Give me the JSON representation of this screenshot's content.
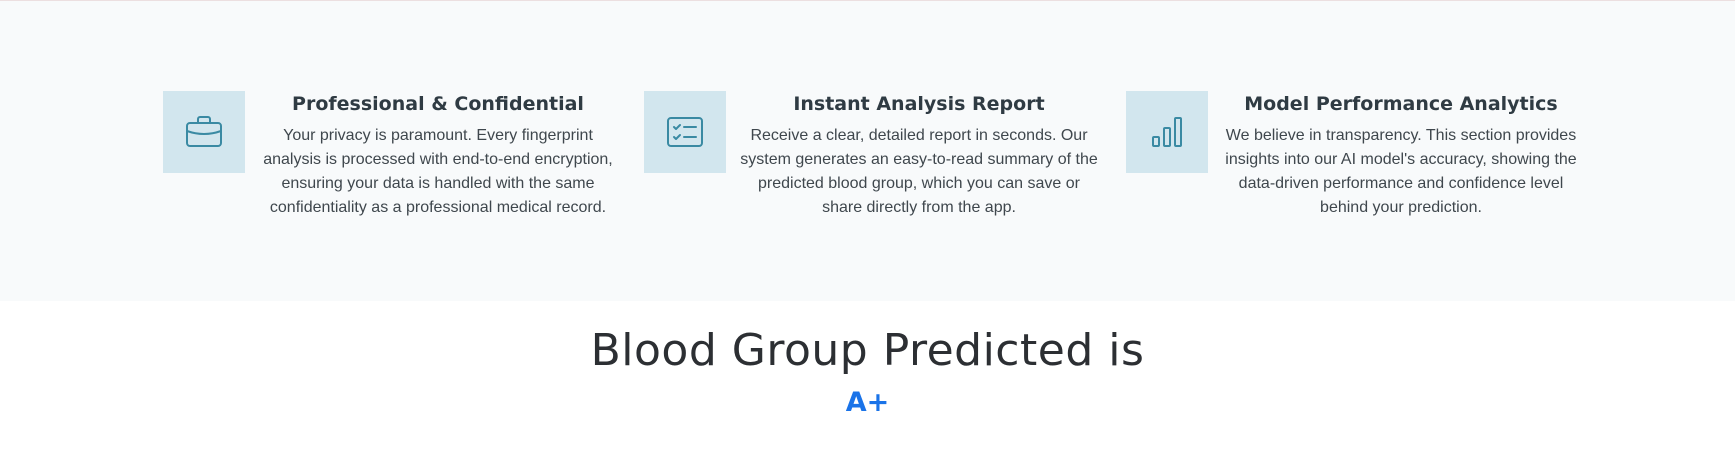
{
  "features": [
    {
      "icon": "briefcase-icon",
      "title": "Professional & Confidential",
      "description": "Your privacy is paramount. Every fingerprint analysis is processed with end-to-end encryption, ensuring your data is handled with the same confidentiality as a professional medical record."
    },
    {
      "icon": "checklist-icon",
      "title": "Instant Analysis Report",
      "description": "Receive a clear, detailed report in seconds. Our system generates an easy-to-read summary of the predicted blood group, which you can save or share directly from the app."
    },
    {
      "icon": "bar-chart-icon",
      "title": "Model Performance Analytics",
      "description": "We believe in transparency. This section provides insights into our AI model's accuracy, showing the data-driven performance and confidence level behind your prediction."
    }
  ],
  "result": {
    "heading": "Blood Group Predicted is",
    "value": "A+"
  },
  "colors": {
    "icon_stroke": "#3a8aa3",
    "icon_box_bg": "#d2e6ee",
    "section_bg": "#f8fafb",
    "result_value": "#1a73e8"
  }
}
